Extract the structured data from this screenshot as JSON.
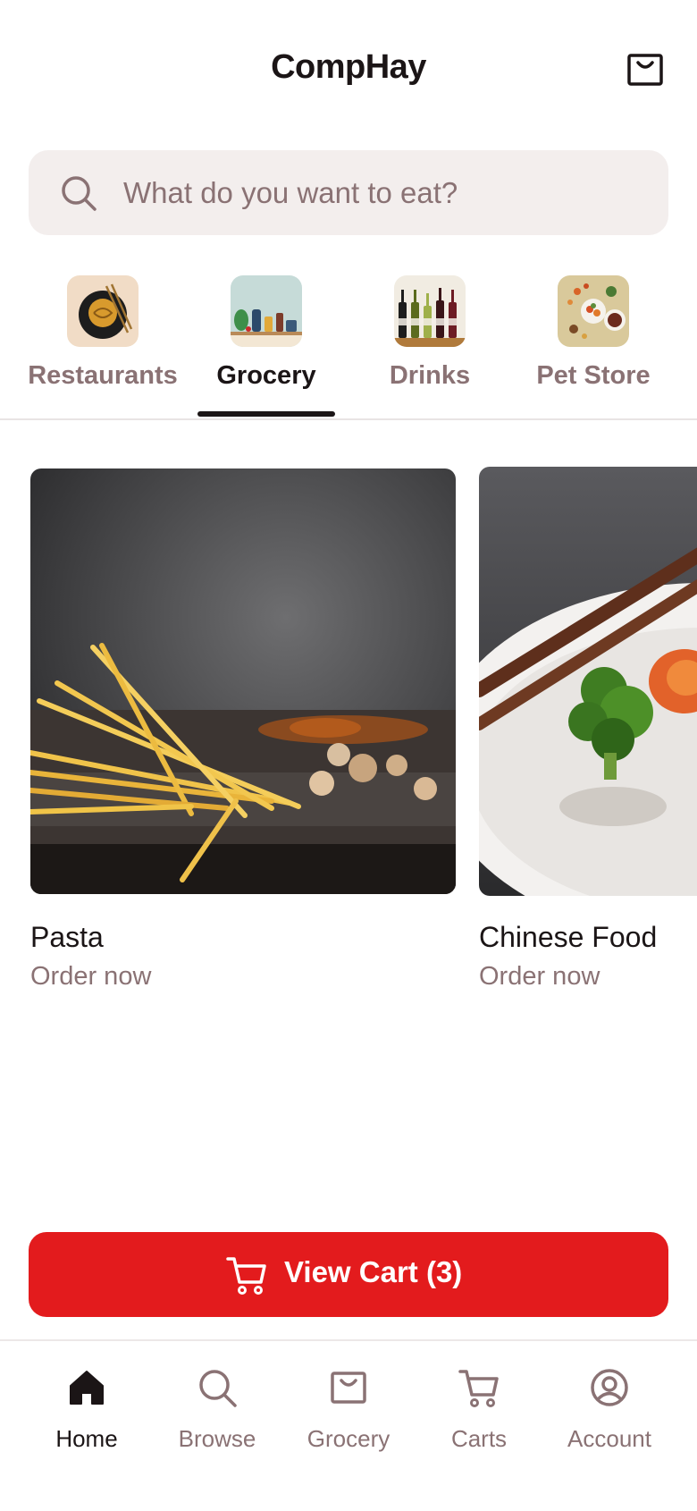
{
  "header": {
    "title": "CompHay",
    "bag_icon": "shopping-bag-icon"
  },
  "search": {
    "placeholder": "What do you want to eat?",
    "value": "",
    "icon": "search-icon"
  },
  "categories": {
    "active": "Grocery",
    "items": [
      {
        "label": "Restaurants",
        "icon": "noodle-bowl-thumbnail"
      },
      {
        "label": "Grocery",
        "icon": "grocery-shelf-thumbnail"
      },
      {
        "label": "Drinks",
        "icon": "bottles-thumbnail"
      },
      {
        "label": "Pet Store",
        "icon": "food-bowls-thumbnail"
      }
    ]
  },
  "cards": [
    {
      "title": "Pasta",
      "subtitle": "Order now",
      "image": "pasta-photo"
    },
    {
      "title": "Chinese Food",
      "subtitle": "Order now",
      "image": "chinese-food-photo"
    }
  ],
  "cart_button": {
    "label": "View Cart (3)",
    "icon": "cart-icon"
  },
  "tabbar": {
    "active": "Home",
    "items": [
      {
        "label": "Home",
        "icon": "home-icon"
      },
      {
        "label": "Browse",
        "icon": "search-icon"
      },
      {
        "label": "Grocery",
        "icon": "shopping-bag-icon"
      },
      {
        "label": "Carts",
        "icon": "cart-icon"
      },
      {
        "label": "Account",
        "icon": "account-icon"
      }
    ]
  },
  "colors": {
    "accent": "#e31b1d",
    "text": "#1b1516",
    "muted": "#8a7274",
    "search_bg": "#f3eeed"
  }
}
